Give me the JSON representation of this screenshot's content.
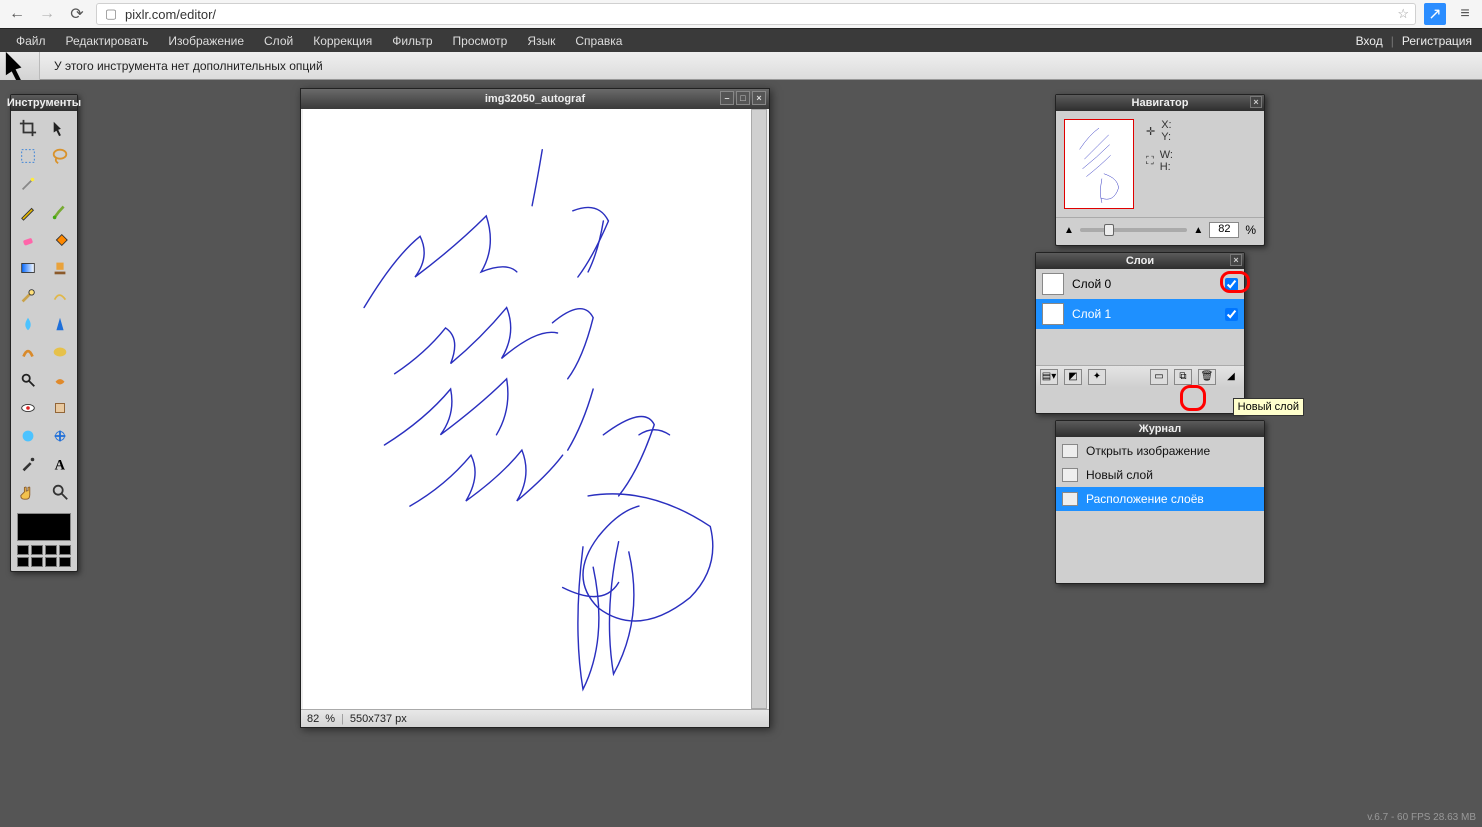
{
  "browser": {
    "url_display": "pixlr.com/editor/",
    "back_enabled": true,
    "forward_enabled": false
  },
  "menubar": {
    "items": [
      "Файл",
      "Редактировать",
      "Изображение",
      "Слой",
      "Коррекция",
      "Фильтр",
      "Просмотр",
      "Язык",
      "Справка"
    ],
    "login": "Вход",
    "register": "Регистрация"
  },
  "optionbar": {
    "text": "У этого инструмента нет дополнительных опций"
  },
  "tools_panel": {
    "title": "Инструменты"
  },
  "document_window": {
    "title": "img32050_autograf",
    "status_zoom": "82",
    "status_zoom_unit": "%",
    "status_size": "550x737 px"
  },
  "navigator": {
    "title": "Навигатор",
    "labels": {
      "x": "X:",
      "y": "Y:",
      "w": "W:",
      "h": "H:"
    },
    "zoom_value": "82",
    "zoom_unit": "%"
  },
  "layers": {
    "title": "Слои",
    "items": [
      {
        "name": "Слой 0",
        "visible": true,
        "selected": false,
        "transparent_thumb": false
      },
      {
        "name": "Слой 1",
        "visible": true,
        "selected": true,
        "transparent_thumb": true
      }
    ],
    "tooltip": "Новый слой"
  },
  "history": {
    "title": "Журнал",
    "items": [
      {
        "label": "Открыть изображение",
        "selected": false
      },
      {
        "label": "Новый слой",
        "selected": false
      },
      {
        "label": "Расположение слоёв",
        "selected": true
      }
    ]
  },
  "footer": {
    "status": "v.6.7 - 60 FPS 28.63 MB"
  }
}
